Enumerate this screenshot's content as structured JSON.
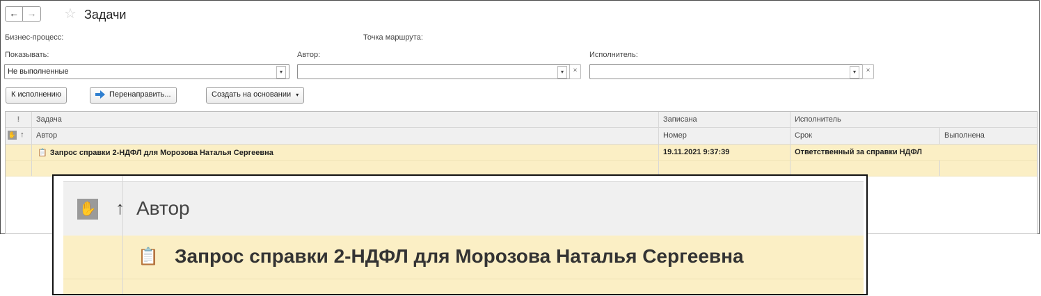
{
  "window": {
    "title": "Задачи",
    "back_icon": "←",
    "forward_icon": "→",
    "favorite_icon": "☆"
  },
  "filters": {
    "business_process_label": "Бизнес-процесс:",
    "route_point_label": "Точка маршрута:",
    "show_label": "Показывать:",
    "show_value": "Не выполненные",
    "author_label": "Автор:",
    "author_value": "",
    "executor_label": "Исполнитель:",
    "executor_value": "",
    "dropdown_icon": "▾",
    "clear_icon": "×"
  },
  "toolbar": {
    "to_execution": "К исполнению",
    "redirect": "Перенаправить...",
    "create_based_on": "Создать на основании",
    "redirect_icon_color": "#2f7fd0"
  },
  "table": {
    "header_row1": [
      "!",
      "Задача",
      "Записана",
      "Исполнитель"
    ],
    "header_row2": [
      "↑",
      "Автор",
      "Номер",
      "Срок",
      "Выполнена"
    ],
    "rows": [
      {
        "task": "Запрос справки 2-НДФЛ для Морозова Наталья Сергеевна",
        "recorded": "19.11.2021 9:37:39",
        "executor": "Ответственный за справки НДФЛ"
      }
    ],
    "selection_color": "#fbefc5"
  },
  "zoom": {
    "sort_arrow": "↑",
    "author_header": "Автор",
    "task_text": "Запрос справки 2-НДФЛ для Морозова Наталья Сергеевна"
  }
}
